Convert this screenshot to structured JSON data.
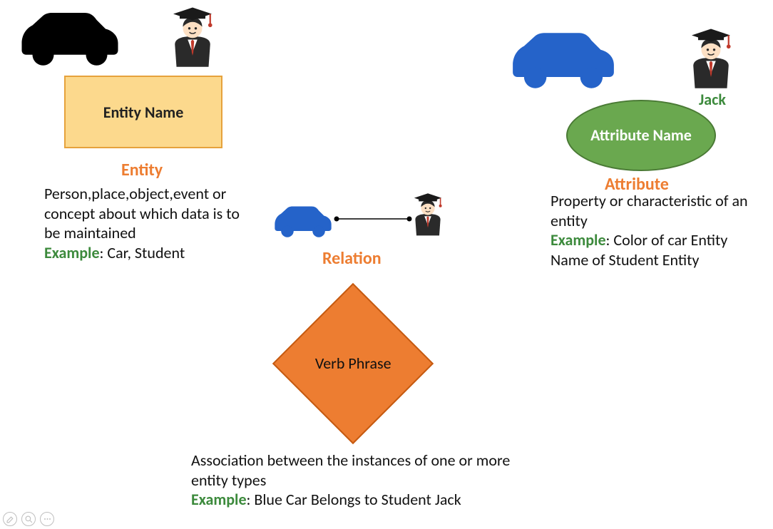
{
  "entity": {
    "box_label": "Entity Name",
    "heading": "Entity",
    "description": "Person,place,object,event or concept about which data is to be maintained",
    "example_label": "Example",
    "example_text": ": Car, Student"
  },
  "relation": {
    "heading": "Relation",
    "diamond_label": "Verb Phrase",
    "description": "Association between the instances of one or more entity types",
    "example_label": "Example",
    "example_text": ": Blue Car Belongs to Student Jack"
  },
  "attribute": {
    "heading": "Attribute",
    "ellipse_label": "Attribute Name",
    "jack_label": "Jack",
    "description": "Property or characteristic of an entity",
    "example_label": "Example",
    "example_text": ": Color of car Entity Name of Student Entity"
  },
  "icons": {
    "car_black": "car-icon-black",
    "car_blue": "car-icon-blue",
    "student": "student-icon"
  }
}
